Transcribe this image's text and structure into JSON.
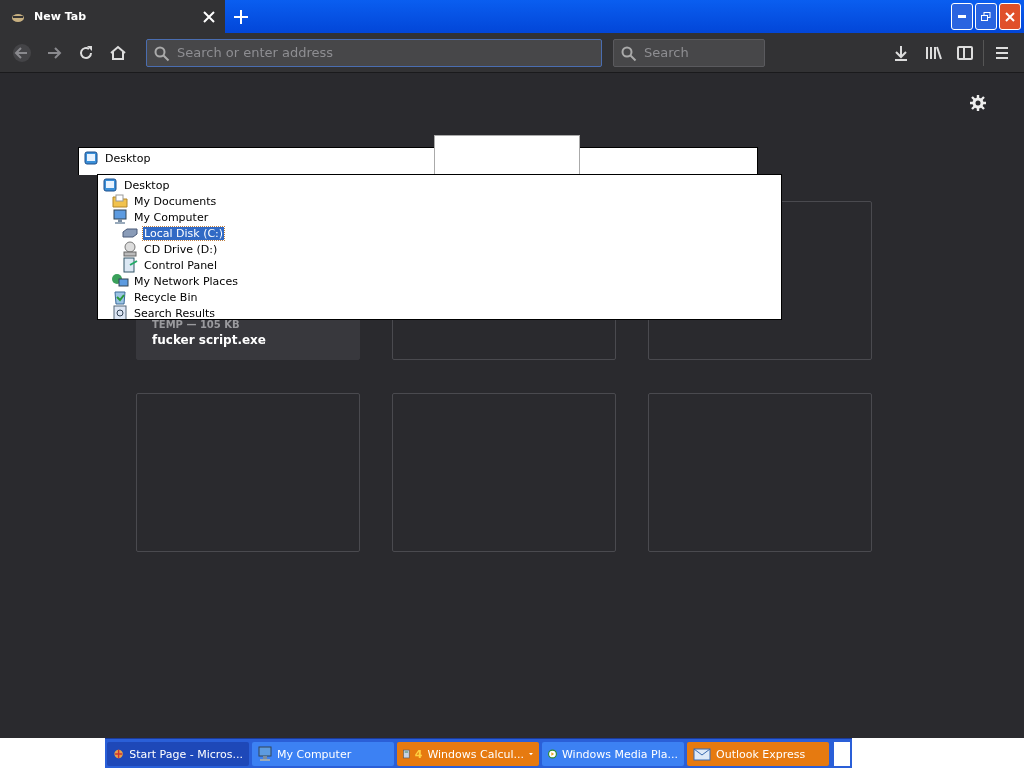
{
  "browser": {
    "tab": {
      "title": "New Tab",
      "selected": true
    },
    "address": {
      "placeholder": "Search or enter address"
    },
    "search": {
      "placeholder": "Search"
    }
  },
  "tiles": [
    {
      "kind": "file",
      "label": "TEMP — 105 KB",
      "title": "fucker script.exe"
    },
    {
      "kind": "empty"
    },
    {
      "kind": "empty"
    },
    {
      "kind": "empty"
    },
    {
      "kind": "empty"
    },
    {
      "kind": "empty"
    }
  ],
  "back_tree": {
    "items": [
      {
        "kind": "desktop",
        "label": "Desktop",
        "selected": false
      }
    ]
  },
  "tree": {
    "items": [
      {
        "kind": "desktop",
        "label": "Desktop",
        "selected": false,
        "children": [
          {
            "kind": "folder",
            "label": "My Documents",
            "selected": false
          },
          {
            "kind": "computer",
            "label": "My Computer",
            "selected": false,
            "children": [
              {
                "kind": "disk",
                "label": "Local Disk (C:)",
                "selected": true
              },
              {
                "kind": "cd",
                "label": "CD Drive (D:)",
                "selected": false
              },
              {
                "kind": "panel",
                "label": "Control Panel",
                "selected": false
              }
            ]
          },
          {
            "kind": "network",
            "label": "My Network Places",
            "selected": false
          },
          {
            "kind": "bin",
            "label": "Recycle Bin",
            "selected": false
          },
          {
            "kind": "search",
            "label": "Search Results",
            "selected": false
          }
        ]
      }
    ]
  },
  "taskbar": {
    "items": [
      {
        "kind": "browser",
        "label": "Start Page - Micros...",
        "flashing": false,
        "active": true
      },
      {
        "kind": "computer",
        "label": "My Computer",
        "flashing": false,
        "active": false
      },
      {
        "kind": "calculator",
        "count": "4",
        "label": "Windows Calcul...",
        "flashing": true,
        "active": false
      },
      {
        "kind": "media",
        "label": "Windows Media Pla...",
        "flashing": false,
        "active": false
      },
      {
        "kind": "mail",
        "label": "Outlook Express",
        "flashing": true,
        "active": false
      }
    ]
  }
}
